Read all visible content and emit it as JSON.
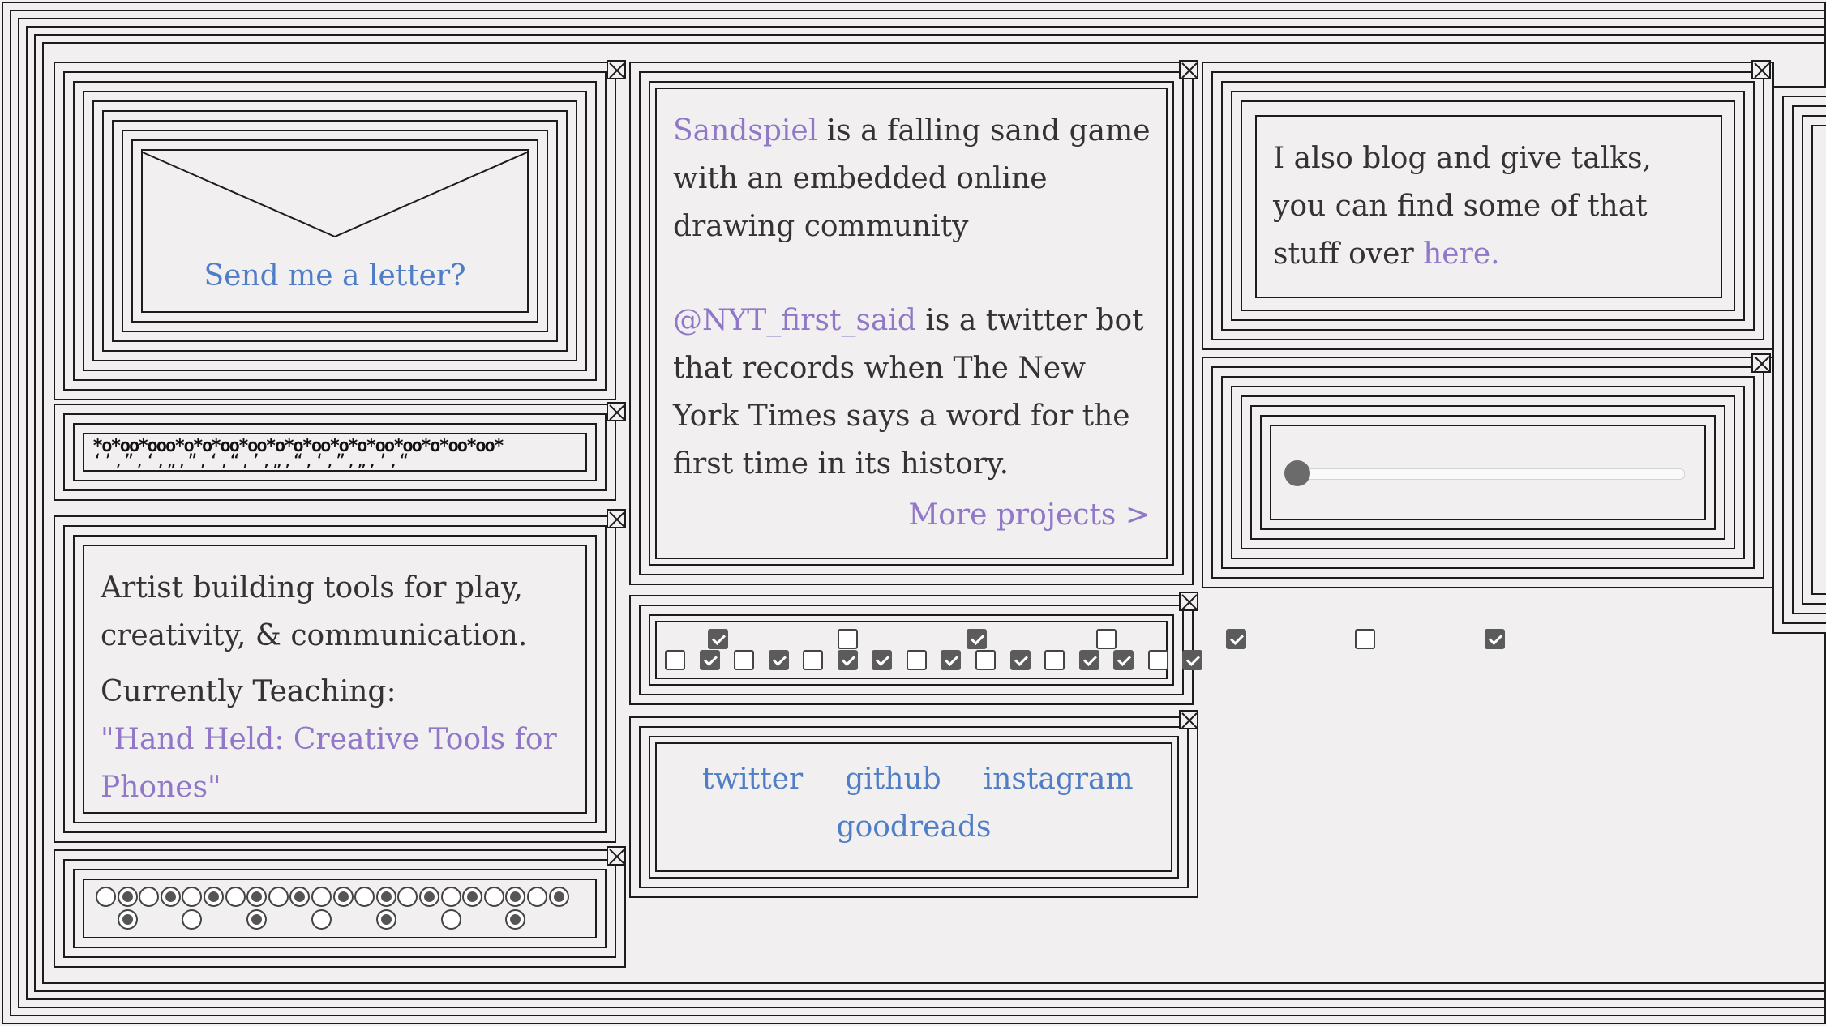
{
  "letter": {
    "label": "Send me a letter?"
  },
  "noise": {
    "row1": "*o*oo*ooo*o*o*oo*oo*o*o*oo*o*o*oo*oo*o*oo*oo*",
    "row2": "‘’,”,‘,„,”,‘,“,’,„,“,‘,”,„,’,“"
  },
  "about": {
    "intro": "Artist building tools for play, creativity, & communication.",
    "teaching_label": "Currently Teaching:",
    "teaching_course": "\"Hand Held: Creative Tools for Phones\""
  },
  "radios": {
    "top": [
      false,
      true,
      false,
      true,
      false,
      true,
      false,
      true,
      false,
      true,
      false,
      true,
      false,
      true,
      false,
      true,
      false,
      true,
      false,
      true,
      false,
      true
    ],
    "bottom": [
      true,
      false,
      true,
      false,
      true,
      false,
      true
    ]
  },
  "projects": {
    "sandspiel_link": "Sandspiel",
    "sandspiel_text": " is a falling sand game with an embedded online drawing community",
    "nyt_link": "@NYT_first_said",
    "nyt_text": " is a twitter bot that records when The New York Times says a word for the first time in its history.",
    "more_link": "More projects >"
  },
  "checkboxes": {
    "top": [
      true,
      false,
      true,
      false,
      true,
      false,
      true
    ],
    "bottom": [
      false,
      true,
      false,
      true,
      false,
      true,
      true,
      false,
      true,
      false,
      true,
      false,
      true,
      true,
      false,
      true,
      false,
      true,
      false,
      true,
      true,
      false,
      true,
      false,
      true,
      false,
      true,
      true
    ]
  },
  "social": {
    "links": [
      "twitter",
      "github",
      "instagram",
      "goodreads"
    ]
  },
  "blog": {
    "text": "I also blog and give talks, you can find some of that stuff over ",
    "link": "here."
  },
  "slider": {
    "value": 0
  },
  "colors": {
    "link_blue": "#4f7ec7",
    "link_purple": "#9077c7",
    "background": "#f2eff0",
    "ink": "#1c1c1c"
  }
}
